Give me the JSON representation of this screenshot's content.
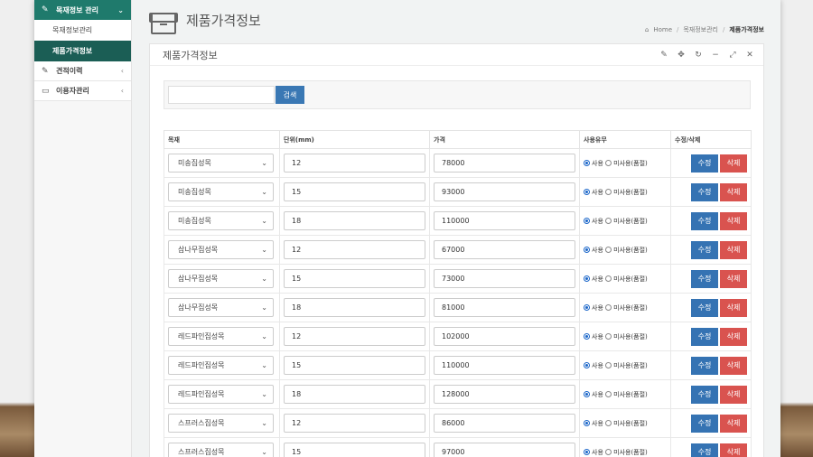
{
  "sidebar": {
    "menus": [
      {
        "label": "목재정보 관리",
        "icon": "edit-icon",
        "expanded": true,
        "sub": [
          {
            "label": "목재정보관리",
            "active": false
          },
          {
            "label": "제품가격정보",
            "active": true
          }
        ]
      },
      {
        "label": "견적이력",
        "icon": "edit-icon",
        "expanded": false
      },
      {
        "label": "이용자관리",
        "icon": "calendar-icon",
        "expanded": false
      }
    ]
  },
  "header": {
    "title": "제품가격정보",
    "breadcrumb": [
      "Home",
      "목재정보관리",
      "제품가격정보"
    ]
  },
  "panel": {
    "title": "제품가격정보",
    "tools": [
      "pencil-icon",
      "move-icon",
      "refresh-icon",
      "minimize-icon",
      "expand-icon",
      "close-icon"
    ]
  },
  "search": {
    "input_value": "",
    "button_label": "검색"
  },
  "table": {
    "headers": [
      "목재",
      "단위(mm)",
      "가격",
      "사용유무",
      "수정/삭제"
    ],
    "radio_labels": [
      "사용",
      "미사용(품절)"
    ],
    "edit_label": "수정",
    "delete_label": "삭제",
    "rows": [
      {
        "wood": "미송집성목",
        "unit": "12",
        "price": "78000",
        "use": true
      },
      {
        "wood": "미송집성목",
        "unit": "15",
        "price": "93000",
        "use": true
      },
      {
        "wood": "미송집성목",
        "unit": "18",
        "price": "110000",
        "use": true
      },
      {
        "wood": "삼나무집성목",
        "unit": "12",
        "price": "67000",
        "use": true
      },
      {
        "wood": "삼나무집성목",
        "unit": "15",
        "price": "73000",
        "use": true
      },
      {
        "wood": "삼나무집성목",
        "unit": "18",
        "price": "81000",
        "use": true
      },
      {
        "wood": "레드파인집성목",
        "unit": "12",
        "price": "102000",
        "use": true
      },
      {
        "wood": "레드파인집성목",
        "unit": "15",
        "price": "110000",
        "use": true
      },
      {
        "wood": "레드파인집성목",
        "unit": "18",
        "price": "128000",
        "use": true
      },
      {
        "wood": "스프러스집성목",
        "unit": "12",
        "price": "86000",
        "use": true
      },
      {
        "wood": "스프러스집성목",
        "unit": "15",
        "price": "97000",
        "use": true
      }
    ]
  },
  "colors": {
    "sidebar_active": "#1f7a6c",
    "primary_button": "#3573b3",
    "danger_button": "#d9534f"
  }
}
